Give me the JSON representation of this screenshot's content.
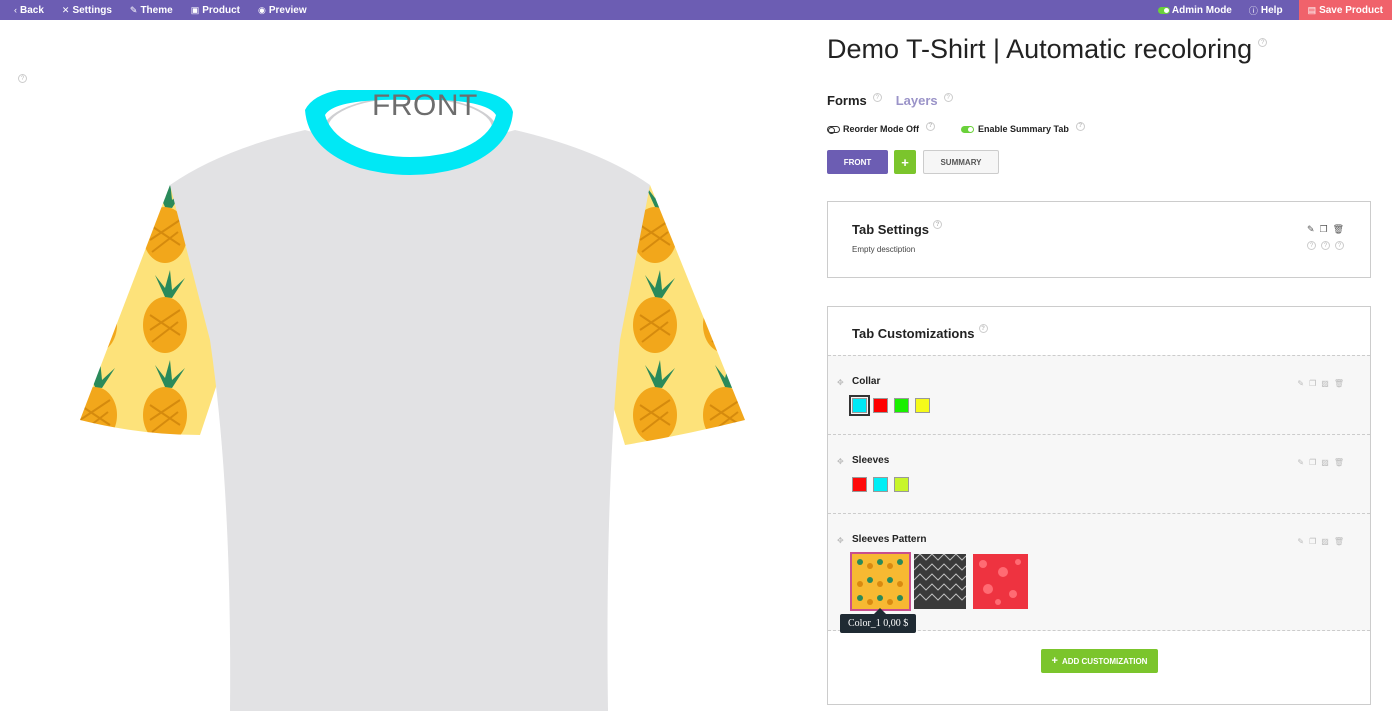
{
  "topbar": {
    "back": "Back",
    "settings": "Settings",
    "theme": "Theme",
    "product": "Product",
    "preview": "Preview",
    "admin_mode": "Admin Mode",
    "help": "Help",
    "save": "Save Product",
    "color": "#6c5db3",
    "save_color": "#f0626b"
  },
  "preview": {
    "view_label": "FRONT",
    "collar_color": "#00e8f5"
  },
  "panel": {
    "title": "Demo T-Shirt | Automatic recoloring",
    "tabs": [
      {
        "label": "Forms",
        "active": true
      },
      {
        "label": "Layers",
        "active": false
      }
    ],
    "options": {
      "reorder": "Reorder Mode Off",
      "summary_tab": "Enable Summary Tab"
    },
    "buttons": {
      "front": "FRONT",
      "plus": "+",
      "summary": "SUMMARY"
    },
    "tab_settings": {
      "title": "Tab Settings",
      "description": "Empty desctiption"
    },
    "tab_customizations": {
      "title": "Tab Customizations",
      "items": [
        {
          "name": "Collar",
          "swatches": [
            "#00e8f5",
            "#ff0000",
            "#19f000",
            "#f5fa1a"
          ],
          "selected": 0
        },
        {
          "name": "Sleeves",
          "swatches": [
            "#ff0a0a",
            "#00eef5",
            "#c8f52a"
          ],
          "selected": -1
        },
        {
          "name": "Sleeves Pattern",
          "patterns": [
            "pineapple",
            "geometric-gray",
            "red-floral"
          ],
          "selected": 0
        }
      ],
      "tooltip": "Color_1  0,00 $",
      "add_button": "ADD CUSTOMIZATION"
    }
  }
}
